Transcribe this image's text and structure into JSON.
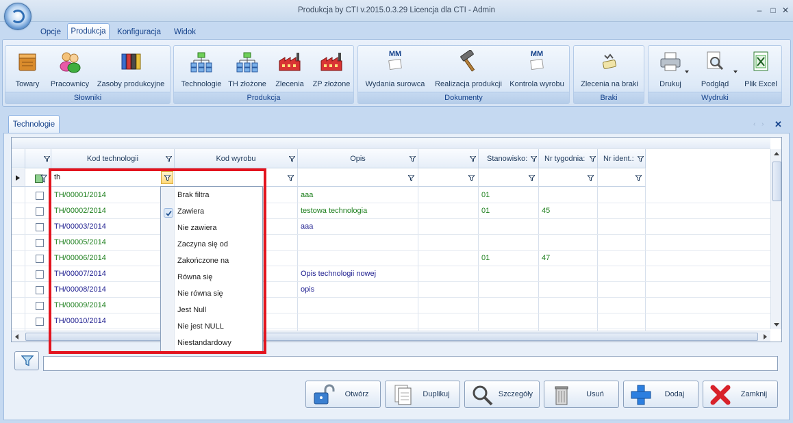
{
  "window": {
    "title": "Produkcja by CTI v.2015.0.3.29 Licencja dla CTI - Admin",
    "minimize": "–",
    "maximize": "□",
    "close": "✕"
  },
  "menu_tabs": [
    "Opcje",
    "Produkcja",
    "Konfiguracja",
    "Widok"
  ],
  "active_menu_tab": "Produkcja",
  "ribbon": {
    "groups": [
      {
        "label": "Słowniki",
        "buttons": [
          "Towary",
          "Pracownicy",
          "Zasoby produkcyjne"
        ]
      },
      {
        "label": "Produkcja",
        "buttons": [
          "Technologie",
          "TH złożone",
          "Zlecenia",
          "ZP złożone"
        ]
      },
      {
        "label": "Dokumenty",
        "buttons": [
          "Wydania surowca",
          "Realizacja produkcji",
          "Kontrola wyrobu"
        ]
      },
      {
        "label": "Braki",
        "buttons": [
          "Zlecenia na braki"
        ]
      },
      {
        "label": "Wydruki",
        "buttons": [
          "Drukuj",
          "Podgląd",
          "Plik Excel"
        ]
      }
    ],
    "mm_badge": "MM"
  },
  "document_tab": "Technologie",
  "tab_close": "✕",
  "tab_nav": "‹ ›",
  "grid": {
    "columns": [
      "Kod technologii",
      "Kod wyrobu",
      "Opis",
      "",
      "Stanowisko:",
      "Nr tygodnia:",
      "Nr ident.:"
    ],
    "filter_value": "th",
    "rows": [
      {
        "kod": "TH/00001/2014",
        "opis": "aaa",
        "stan": "01",
        "tyg": ""
      },
      {
        "kod": "TH/00002/2014",
        "opis": "testowa technologia",
        "stan": "01",
        "tyg": "45"
      },
      {
        "kod": "TH/00003/2014",
        "opis": "aaa",
        "stan": "",
        "tyg": ""
      },
      {
        "kod": "TH/00005/2014",
        "opis": "",
        "stan": "",
        "tyg": ""
      },
      {
        "kod": "TH/00006/2014",
        "opis": "",
        "stan": "01",
        "tyg": "47"
      },
      {
        "kod": "TH/00007/2014",
        "opis": "Opis technologii nowej",
        "stan": "",
        "tyg": ""
      },
      {
        "kod": "TH/00008/2014",
        "opis": "opis",
        "stan": "",
        "tyg": ""
      },
      {
        "kod": "TH/00009/2014",
        "opis": "",
        "stan": "",
        "tyg": ""
      },
      {
        "kod": "TH/00010/2014",
        "opis": "",
        "stan": "",
        "tyg": ""
      }
    ]
  },
  "filter_menu": {
    "items": [
      "Brak filtra",
      "Zawiera",
      "Nie zawiera",
      "Zaczyna się od",
      "Zakończone na",
      "Równa się",
      "Nie równa się",
      "Jest Null",
      "Nie jest NULL",
      "Niestandardowy"
    ],
    "checked": "Zawiera"
  },
  "actions": [
    "Otwórz",
    "Duplikuj",
    "Szczegóły",
    "Usuń",
    "Dodaj",
    "Zamknij"
  ],
  "colors": {
    "highlight": "#e3141e",
    "ribbon_bg": "#dde9f7",
    "accent": "#15428b"
  }
}
